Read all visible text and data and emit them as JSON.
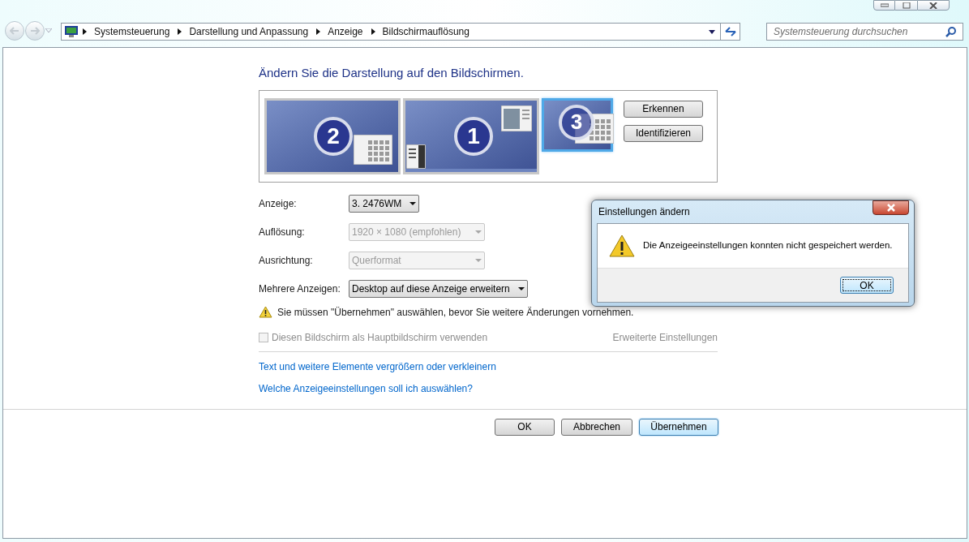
{
  "address_bar": {
    "crumbs": [
      "Systemsteuerung",
      "Darstellung und Anpassung",
      "Anzeige",
      "Bildschirmauflösung"
    ]
  },
  "search": {
    "placeholder": "Systemsteuerung durchsuchen"
  },
  "heading": "Ändern Sie die Darstellung auf den Bildschirmen.",
  "monitors": [
    {
      "label": "2",
      "selected": false
    },
    {
      "label": "1",
      "selected": false
    },
    {
      "label": "3",
      "selected": true
    }
  ],
  "monitor_buttons": [
    "Erkennen",
    "Identifizieren"
  ],
  "settings": [
    {
      "label": "Anzeige:",
      "value": "3. 2476WM",
      "disabled": false
    },
    {
      "label": "Auflösung:",
      "value": "1920 × 1080 (empfohlen)",
      "disabled": true
    },
    {
      "label": "Ausrichtung:",
      "value": "Querformat",
      "disabled": true
    },
    {
      "label": "Mehrere Anzeigen:",
      "value": "Desktop auf diese Anzeige erweitern",
      "disabled": false
    }
  ],
  "warning": "Sie müssen \"Übernehmen\" auswählen, bevor Sie weitere Änderungen vornehmen.",
  "primary_checkbox": {
    "label": "Diesen Bildschirm als Hauptbildschirm verwenden",
    "checked": false,
    "disabled": true
  },
  "advanced_link": {
    "label": "Erweiterte Einstellungen",
    "disabled": true
  },
  "links": [
    "Text und weitere Elemente vergrößern oder verkleinern",
    "Welche Anzeigeeinstellungen soll ich auswählen?"
  ],
  "buttons": [
    {
      "label": "OK",
      "selected": false
    },
    {
      "label": "Abbrechen",
      "selected": false
    },
    {
      "label": "Übernehmen",
      "selected": true
    }
  ],
  "dialog": {
    "title": "Einstellungen ändern",
    "message": "Die Anzeigeeinstellungen konnten nicht gespeichert werden.",
    "button": "OK"
  }
}
